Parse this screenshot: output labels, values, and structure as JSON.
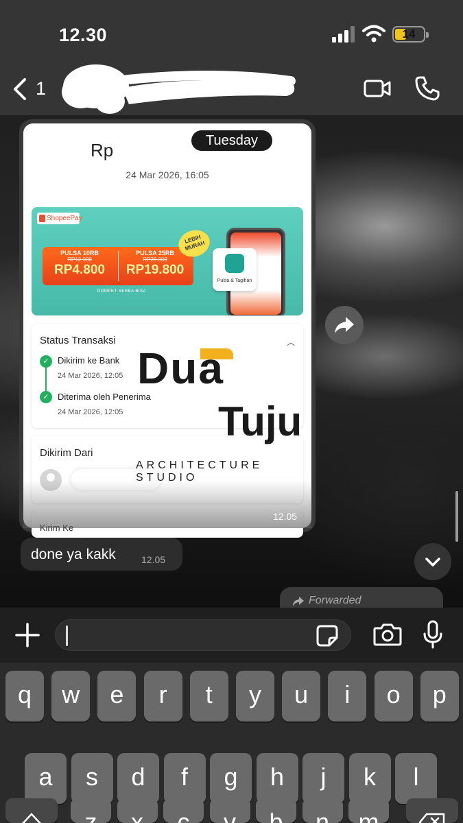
{
  "status_bar": {
    "time": "12.30",
    "battery": "14"
  },
  "header": {
    "back_count": "1"
  },
  "date_pill": "Tuesday",
  "receipt": {
    "amount_prefix": "Rp",
    "datetime": "24 Mar 2026, 16:05",
    "banner": {
      "brand": "ShopeePay",
      "left": {
        "title": "PULSA 10RB",
        "old": "RP12.000",
        "price": "RP4.800"
      },
      "right": {
        "title": "PULSA 25RB",
        "old": "RP26.000",
        "price": "RP19.800"
      },
      "badge": "LEBIH MURAH",
      "footer": "DOMPET SERBA BISA",
      "tile_label": "Pulsa & Tagihan"
    },
    "status": {
      "title": "Status Transaksi",
      "steps": [
        {
          "label": "Dikirim ke Bank",
          "time": "24 Mar 2026, 12:05"
        },
        {
          "label": "Diterima oleh Penerima",
          "time": "24 Mar 2026, 12:05"
        }
      ]
    },
    "sender_title": "Dikirim Dari",
    "next_section": "Kirim Ke",
    "message_time": "12.05"
  },
  "watermark": {
    "line1": "Dua",
    "line2": "Tuju",
    "line3": "ARCHITECTURE STUDIO"
  },
  "messages": [
    {
      "text": "done ya kakk",
      "time": "12.05"
    }
  ],
  "forwarded_label": "Forwarded",
  "keyboard": {
    "row1": [
      "q",
      "w",
      "e",
      "r",
      "t",
      "y",
      "u",
      "i",
      "o",
      "p"
    ],
    "row2": [
      "a",
      "s",
      "d",
      "f",
      "g",
      "h",
      "j",
      "k",
      "l"
    ],
    "row3": [
      "z",
      "x",
      "c",
      "v",
      "b",
      "n",
      "m"
    ]
  },
  "colors": {
    "accent_green": "#21b060",
    "shopee_orange": "#ee4d2d",
    "watermark_yellow": "#f2b01e"
  }
}
